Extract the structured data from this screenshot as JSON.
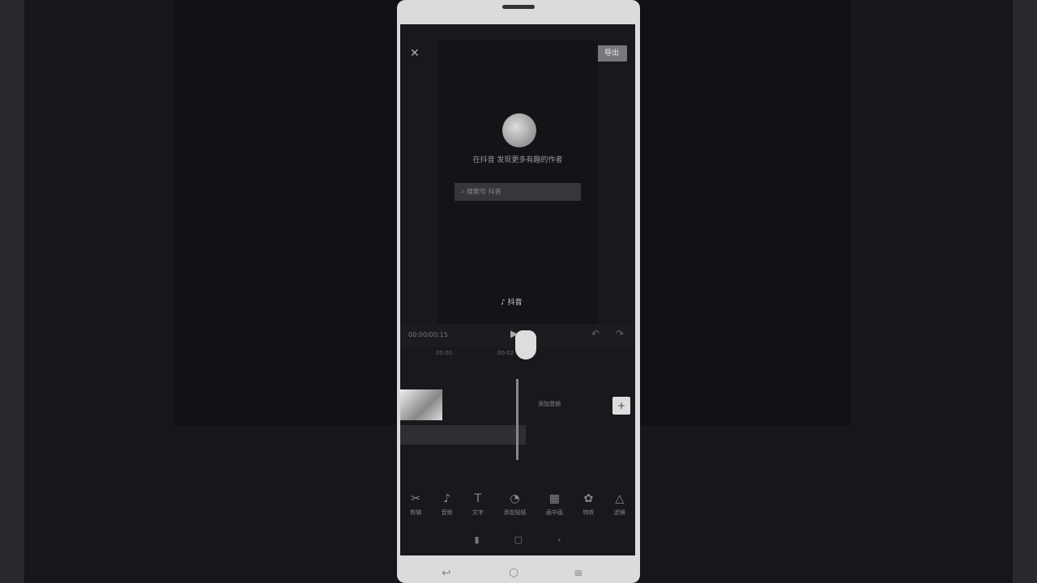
{
  "editor": {
    "close_icon": "close-icon",
    "fullscreen_icon": "fullscreen-icon",
    "export_label": "导出",
    "preview": {
      "caption": "在抖音 发现更多有趣的作者",
      "search_placeholder": "搜索号 抖音",
      "logo_text": "抖音"
    },
    "timecode": "00:00/00:15",
    "ruler": [
      "00:00",
      "00:02"
    ],
    "add_audio": "添加音频",
    "add_clip": "+",
    "tools": [
      {
        "icon": "scissors-icon",
        "glyph": "✂",
        "label": "剪辑"
      },
      {
        "icon": "music-icon",
        "glyph": "♪",
        "label": "音频"
      },
      {
        "icon": "text-icon",
        "glyph": "T",
        "label": "文字"
      },
      {
        "icon": "sticker-icon",
        "glyph": "◔",
        "label": "添加贴纸"
      },
      {
        "icon": "pip-icon",
        "glyph": "▦",
        "label": "画中画"
      },
      {
        "icon": "effects-icon",
        "glyph": "✿",
        "label": "特效"
      },
      {
        "icon": "filter-icon",
        "glyph": "△",
        "label": "滤镜"
      }
    ],
    "nav": {
      "menu": "▮",
      "home": "▢",
      "back": "‹"
    }
  }
}
